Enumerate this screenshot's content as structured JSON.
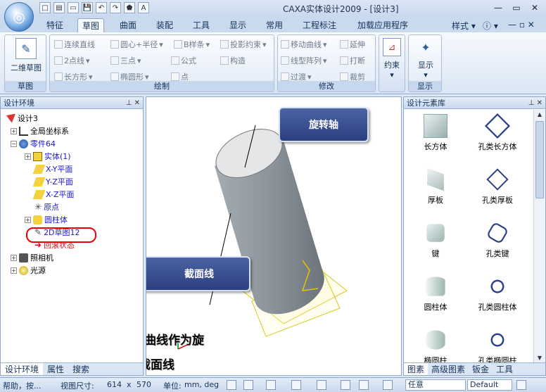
{
  "window": {
    "title": "CAXA实体设计2009 - [设计3]",
    "minimize": "—",
    "restore": "▭",
    "close": "✕"
  },
  "quick_access": [
    "□",
    "▤",
    "▭",
    "💾",
    "↶",
    "↷",
    "⬟",
    "A"
  ],
  "tabs": [
    "特征",
    "草图",
    "曲面",
    "装配",
    "工具",
    "显示",
    "常用",
    "工程标注",
    "加载应用程序"
  ],
  "active_tab": "草图",
  "style_menu": "样式",
  "ribbon": {
    "sketch_group": {
      "button": "二维草图",
      "label": "草图"
    },
    "draw_group": {
      "label": "绘制",
      "items": [
        "连续直线",
        "圆心+半径",
        "B样条",
        "投影约束",
        "2点线",
        "三点",
        "构造",
        "长方形",
        "椭圆形",
        "公式",
        "点"
      ]
    },
    "modify_group": {
      "label": "修改",
      "items": [
        "移动曲线",
        "延伸",
        "线型阵列",
        "打断",
        "过渡",
        "裁剪"
      ]
    },
    "constraint_group": {
      "button": "约束"
    },
    "display_group": {
      "button": "显示",
      "label": "显示"
    }
  },
  "left_panel": {
    "title": "设计环境",
    "tree": [
      {
        "label": "设计3",
        "color": "black"
      },
      {
        "label": "全局坐标系",
        "color": "black"
      },
      {
        "label": "零件64",
        "color": "blue"
      },
      {
        "label": "实体(1)",
        "color": "blue"
      },
      {
        "label": "X-Y平面",
        "color": "blue"
      },
      {
        "label": "Y-Z平面",
        "color": "blue"
      },
      {
        "label": "X-Z平面",
        "color": "blue"
      },
      {
        "label": "原点",
        "color": "blue"
      },
      {
        "label": "圆柱体",
        "color": "blue"
      },
      {
        "label": "2D草图12",
        "color": "blue"
      },
      {
        "label": "回滚状态",
        "color": "red"
      },
      {
        "label": "照相机",
        "color": "black"
      },
      {
        "label": "光源",
        "color": "black"
      }
    ],
    "bottom_tabs": [
      "设计环境",
      "属性",
      "搜索"
    ]
  },
  "viewport": {
    "callouts": {
      "axis": "旋转轴",
      "section": "截面线"
    },
    "note_line1": "在此处我用草图曲线作为旋",
    "note_line2": "转轴和截面线"
  },
  "right_panel": {
    "title": "设计元素库",
    "items": [
      "长方体",
      "孔类长方体",
      "厚板",
      "孔类厚板",
      "键",
      "孔类键",
      "圆柱体",
      "孔类圆柱体",
      "椭圆柱",
      "孔类椭圆柱"
    ],
    "bottom_tabs": [
      "图素",
      "高级图素",
      "钣金",
      "工具"
    ]
  },
  "status_bar": {
    "help": "帮助，按...",
    "view_size_label": "视图尺寸:",
    "view_w": "614",
    "view_x": "x",
    "view_h": "570",
    "unit_label": "单位:",
    "unit_values": "mm, deg",
    "select_value": "任意",
    "profile_value": "Default"
  }
}
